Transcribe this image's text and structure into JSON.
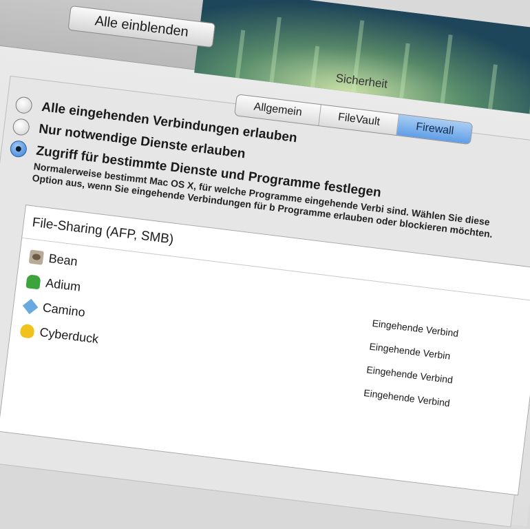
{
  "toolbar": {
    "show_all_label": "Alle einblenden"
  },
  "window": {
    "title": "Sicherheit"
  },
  "tabs": [
    {
      "label": "Allgemein",
      "active": false
    },
    {
      "label": "FileVault",
      "active": false
    },
    {
      "label": "Firewall",
      "active": true
    }
  ],
  "firewall": {
    "options": [
      {
        "label": "Alle eingehenden Verbindungen erlauben",
        "selected": false
      },
      {
        "label": "Nur notwendige Dienste erlauben",
        "selected": false
      },
      {
        "label": "Zugriff für bestimmte Dienste und Programme festlegen",
        "selected": true
      }
    ],
    "description": "Normalerweise bestimmt Mac OS X, für welche Programme eingehende Verbi sind. Wählen Sie diese Option aus, wenn Sie eingehende Verbindungen für b Programme erlauben oder blockieren möchten."
  },
  "list": {
    "header": "File-Sharing (AFP, SMB)",
    "apps": [
      {
        "name": "Bean",
        "icon": "bean-icon",
        "status": ""
      },
      {
        "name": "Adium",
        "icon": "adium-icon",
        "status": "Eingehende Verbind"
      },
      {
        "name": "Camino",
        "icon": "camino-icon",
        "status": "Eingehende Verbin"
      },
      {
        "name": "Cyberduck",
        "icon": "cyberduck-icon",
        "status": "Eingehende Verbind"
      }
    ],
    "extra_status": "Eingehende Verbind"
  }
}
